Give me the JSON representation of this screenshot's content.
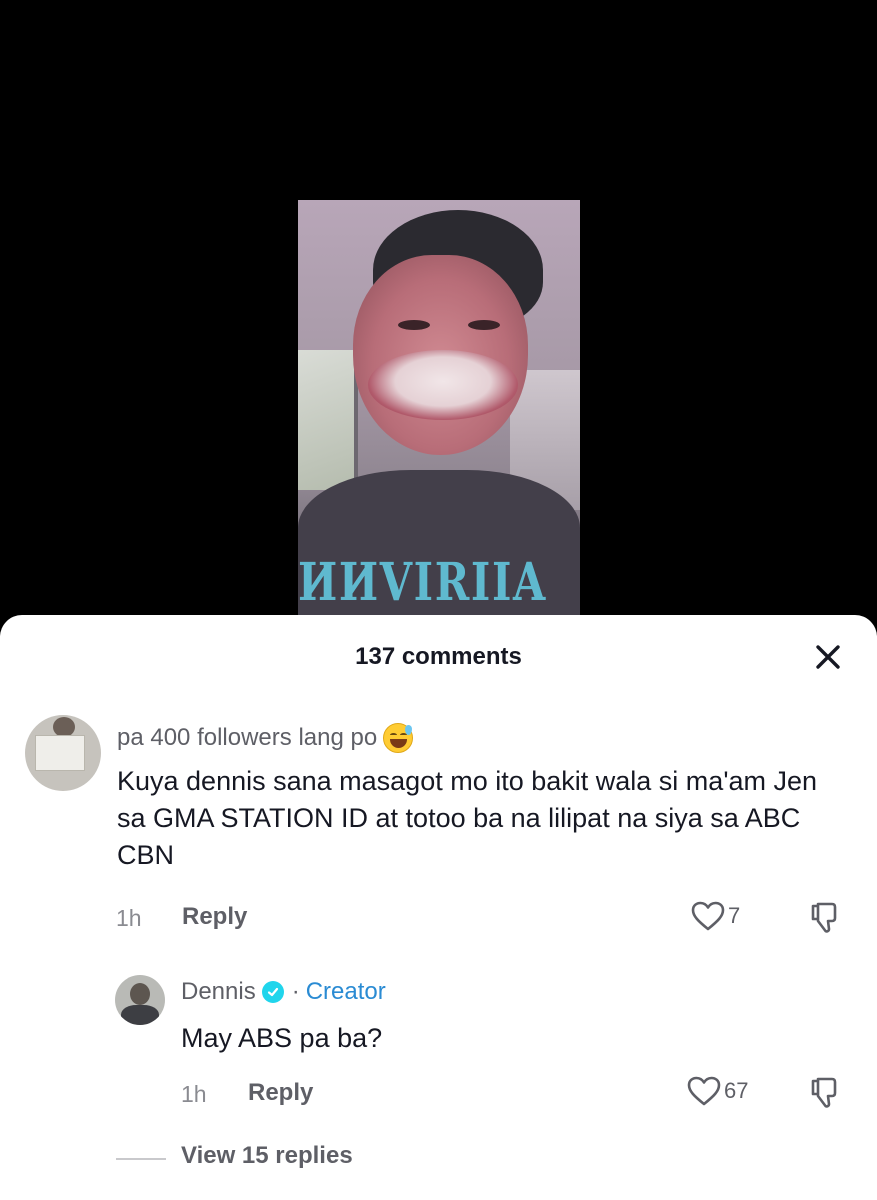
{
  "comments_panel": {
    "title": "137 comments",
    "close_icon": "close-icon"
  },
  "comment": {
    "username": "pa 400 followers lang po",
    "username_emoji": "grinning-face-with-sweat",
    "text": "Kuya dennis sana masagot mo ito bakit wala si ma'am Jen sa GMA STATION ID at totoo ba na lilipat na siya sa ABC CBN",
    "time": "1h",
    "reply_label": "Reply",
    "like_count": "7"
  },
  "reply": {
    "username": "Dennis",
    "separator": "·",
    "creator_label": "Creator",
    "text": "May ABS pa ba?",
    "time": "1h",
    "reply_label": "Reply",
    "like_count": "67"
  },
  "view_replies": "View 15 replies",
  "colors": {
    "sheet_bg": "#ffffff",
    "text_primary": "#161823",
    "text_secondary": "#5e5f66",
    "creator_blue": "#2a8bd3",
    "verified_cyan": "#20d5ec"
  }
}
